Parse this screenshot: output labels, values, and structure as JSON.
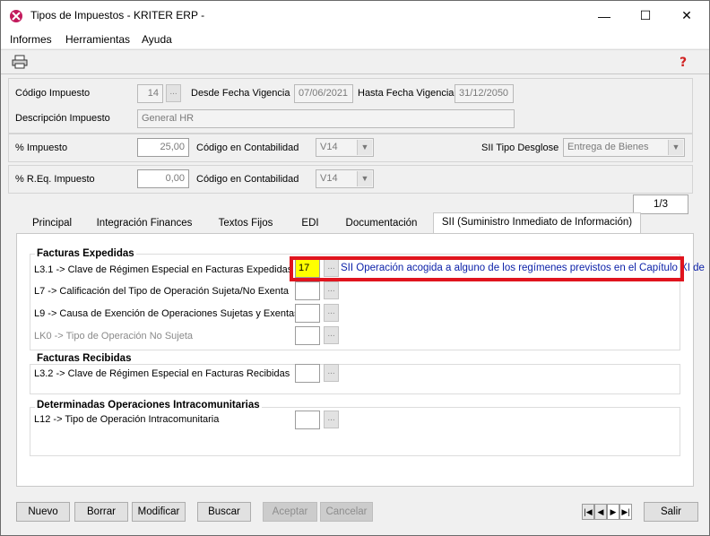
{
  "window": {
    "title": "Tipos de Impuestos - KRITER ERP -",
    "minimize_glyph": "—",
    "maximize_glyph": "☐",
    "close_glyph": "✕"
  },
  "menu": {
    "items": [
      "Informes",
      "Herramientas",
      "Ayuda"
    ]
  },
  "toolbar": {
    "print_icon": "printer-icon",
    "help_icon": "help-icon"
  },
  "header": {
    "codigo_label": "Código Impuesto",
    "codigo_value": "14",
    "ellipsis": "...",
    "desde_label": "Desde Fecha Vigencia",
    "desde_value": "07/06/2021",
    "hasta_label": "Hasta Fecha Vigencia",
    "hasta_value": "31/12/2050",
    "descripcion_label": "Descripción Impuesto",
    "descripcion_value": "General HR"
  },
  "impuesto": {
    "pct_label": "% Impuesto",
    "pct_value": "25,00",
    "contab_label": "Código en Contabilidad",
    "contab_value": "V14",
    "sii_label": "SII Tipo Desglose",
    "sii_value": "Entrega de Bienes"
  },
  "req": {
    "pct_label": "% R.Eq. Impuesto",
    "pct_value": "0,00",
    "contab_label": "Código en Contabilidad",
    "contab_value": "V14"
  },
  "pager": {
    "text": "1/3"
  },
  "tabs": [
    {
      "label": "Principal"
    },
    {
      "label": "Integración Finances"
    },
    {
      "label": "Textos Fijos"
    },
    {
      "label": "EDI"
    },
    {
      "label": "Documentación"
    },
    {
      "label": "SII (Suministro Inmediato de Información)"
    }
  ],
  "sii": {
    "expedidas_title": "Facturas Expedidas",
    "l31_label": "L3.1 -> Clave de Régimen Especial en Facturas Expedidas",
    "l31_value": "17",
    "l31_desc": "SII Operación acogida a alguno de los regímenes previstos en el Capítulo XI de",
    "l7_label": "L7 -> Calificación del Tipo de Operación Sujeta/No Exenta",
    "l9_label": "L9 -> Causa de Exención de Operaciones Sujetas y Exentas",
    "lk0_label": "LK0 -> Tipo de Operación No Sujeta",
    "recibidas_title": "Facturas Recibidas",
    "l32_label": "L3.2 -> Clave de Régimen Especial en Facturas Recibidas",
    "intra_title": "Determinadas Operaciones Intracomunitarias",
    "l12_label": "L12 -> Tipo de Operación Intracomunitaria"
  },
  "buttons": {
    "nuevo": "Nuevo",
    "borrar": "Borrar",
    "modificar": "Modificar",
    "buscar": "Buscar",
    "aceptar": "Aceptar",
    "cancelar": "Cancelar",
    "salir": "Salir"
  },
  "colors": {
    "highlight_frame": "#e0141e",
    "highlight_field": "#ffff00",
    "link_text": "#0a1fa8"
  }
}
